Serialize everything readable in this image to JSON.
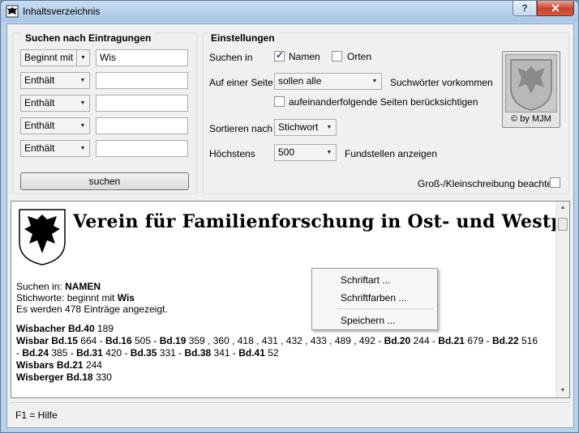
{
  "window": {
    "title": "Inhaltsverzeichnis",
    "help_label": "?",
    "close_label": "✕"
  },
  "search": {
    "group_title": "Suchen nach Eintragungen",
    "rows": [
      {
        "mode": "Beginnt mit",
        "value": "Wis"
      },
      {
        "mode": "Enthält",
        "value": ""
      },
      {
        "mode": "Enthält",
        "value": ""
      },
      {
        "mode": "Enthält",
        "value": ""
      },
      {
        "mode": "Enthält",
        "value": ""
      }
    ],
    "button_label": "suchen"
  },
  "settings": {
    "group_title": "Einstellungen",
    "search_in_label": "Suchen in",
    "names_label": "Namen",
    "names_checked": true,
    "places_label": "Orten",
    "places_checked": false,
    "page_label": "Auf einer Seite",
    "page_value": "sollen alle",
    "page_suffix": "Suchwörter vorkommen",
    "consecutive_label": "aufeinanderfolgende Seiten berücksichtigen",
    "consecutive_checked": false,
    "sort_label": "Sortieren nach",
    "sort_value": "Stichwort",
    "max_label": "Höchstens",
    "max_value": "500",
    "max_suffix": "Fundstellen anzeigen",
    "case_label": "Groß-/Kleinschreibung beachten",
    "case_checked": false,
    "logo_caption": "© by MJM"
  },
  "results": {
    "banner_title": "Verein für Familienforschung in Ost- und Westpreußen",
    "search_in_prefix": "Suchen in:",
    "search_in_value": "NAMEN",
    "keywords_prefix": "Stichworte:  beginnt mit",
    "keywords_value": "Wis",
    "count_text": "Es werden 478 Einträge angezeigt.",
    "entries": [
      {
        "name": "Wisbacher",
        "refs": [
          {
            "vol": "Bd.40",
            "pages": "189"
          }
        ]
      },
      {
        "name": "Wisbar",
        "refs": [
          {
            "vol": "Bd.15",
            "pages": "664"
          },
          {
            "vol": "Bd.16",
            "pages": "505"
          },
          {
            "vol": "Bd.19",
            "pages": "359 , 360 , 418 , 431 , 432 , 433 , 489 , 492"
          },
          {
            "vol": "Bd.20",
            "pages": "244"
          },
          {
            "vol": "Bd.21",
            "pages": "679"
          },
          {
            "vol": "Bd.22",
            "pages": "516"
          },
          {
            "vol": "Bd.24",
            "pages": "385"
          },
          {
            "vol": "Bd.31",
            "pages": "420"
          },
          {
            "vol": "Bd.35",
            "pages": "331"
          },
          {
            "vol": "Bd.38",
            "pages": "341"
          },
          {
            "vol": "Bd.41",
            "pages": "52"
          }
        ]
      },
      {
        "name": "Wisbars",
        "refs": [
          {
            "vol": "Bd.21",
            "pages": "244"
          }
        ]
      },
      {
        "name": "Wisberger",
        "refs": [
          {
            "vol": "Bd.18",
            "pages": "330"
          }
        ]
      }
    ]
  },
  "context_menu": {
    "items": [
      "Schriftart ...",
      "Schriftfarben ...",
      "Speichern ..."
    ]
  },
  "status_text": "F1 = Hilfe"
}
